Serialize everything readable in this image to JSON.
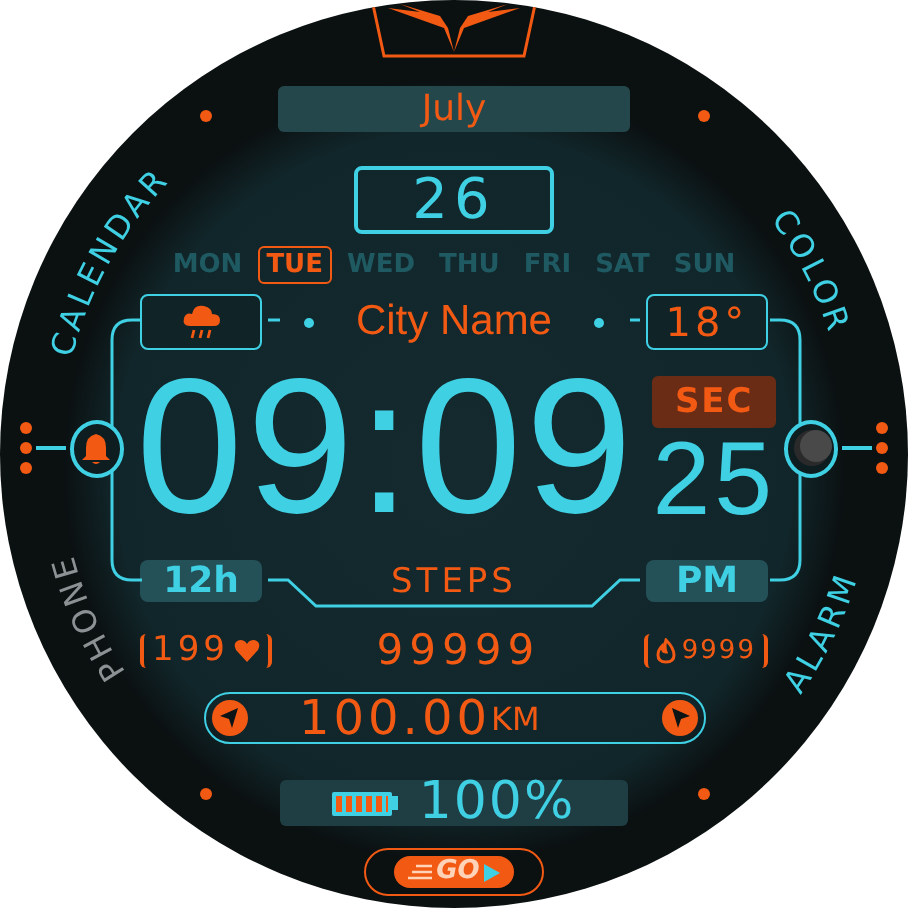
{
  "month": "July",
  "date": "26",
  "weekdays": [
    {
      "label": "MON",
      "selected": false
    },
    {
      "label": "TUE",
      "selected": true
    },
    {
      "label": "WED",
      "selected": false
    },
    {
      "label": "THU",
      "selected": false
    },
    {
      "label": "FRI",
      "selected": false
    },
    {
      "label": "SAT",
      "selected": false
    },
    {
      "label": "SUN",
      "selected": false
    }
  ],
  "city": "City Name",
  "temperature": "18°",
  "time": "09:09",
  "seconds_label": "SEC",
  "seconds": "25",
  "hour_format": "12h",
  "steps_label": "STEPS",
  "period": "PM",
  "heart_rate": "199",
  "steps": "99999",
  "calories": "9999",
  "distance": "100.00",
  "distance_unit": "KM",
  "battery": {
    "level": 1,
    "reading": "100%"
  },
  "go_label": "GO",
  "shortcuts": [
    {
      "label": "CALENDAR",
      "color": "#3fd0e4"
    },
    {
      "label": "COLOR",
      "color": "#3fd0e4"
    },
    {
      "label": "PHONE",
      "color": "#8c9193"
    },
    {
      "label": "ALARM",
      "color": "#3fd0e4"
    }
  ]
}
